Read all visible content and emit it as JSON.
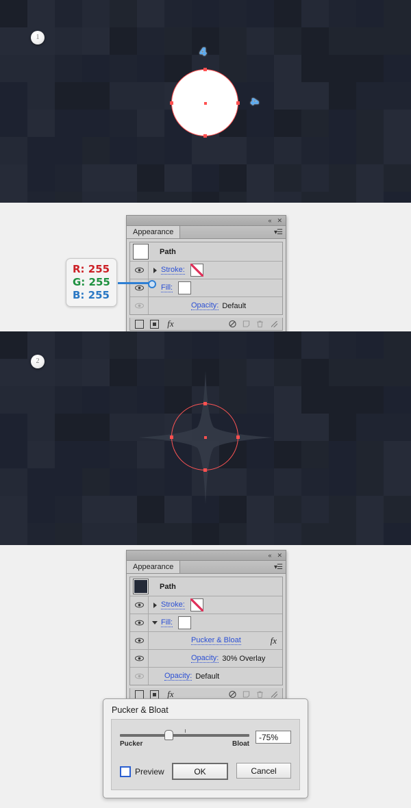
{
  "canvas_1": {
    "step_badge": "1",
    "cursor_labels": [
      "4",
      "4"
    ],
    "shape": "white-circle"
  },
  "canvas_2": {
    "step_badge": "2",
    "shape": "puckered-star"
  },
  "panel_1": {
    "title_icons": {
      "collapse": "«",
      "close": "✕"
    },
    "tab_label": "Appearance",
    "menu_icon": "panel-menu-icon",
    "header": {
      "object_label": "Path",
      "thumbnail": "white"
    },
    "rows": [
      {
        "eye": "on",
        "disclosure": "right",
        "label": "Stroke:",
        "value": "",
        "swatch": "none"
      },
      {
        "eye": "on",
        "disclosure": "none",
        "label": "Fill:",
        "value": "",
        "swatch": "white"
      },
      {
        "eye": "off",
        "disclosure": "none",
        "label": "Opacity:",
        "value": "Default",
        "swatch": ""
      }
    ],
    "footer_icons": [
      "new-stroke",
      "new-fill",
      "fx",
      "clear-appearance",
      "duplicate",
      "delete",
      "resize-grip"
    ],
    "fx_label": "fx"
  },
  "panel_2": {
    "title_icons": {
      "collapse": "«",
      "close": "✕"
    },
    "tab_label": "Appearance",
    "menu_icon": "panel-menu-icon",
    "header": {
      "object_label": "Path",
      "thumbnail": "dark"
    },
    "rows": [
      {
        "eye": "on",
        "disclosure": "right",
        "label": "Stroke:",
        "value": "",
        "swatch": "none"
      },
      {
        "eye": "on",
        "disclosure": "down",
        "label": "Fill:",
        "value": "",
        "swatch": "white"
      },
      {
        "eye": "on",
        "disclosure": "none",
        "label": "Pucker & Bloat",
        "value": "",
        "swatch": "",
        "fx": "fx"
      },
      {
        "eye": "on",
        "disclosure": "none",
        "label": "Opacity:",
        "value": "30% Overlay",
        "swatch": ""
      },
      {
        "eye": "off",
        "disclosure": "none",
        "label": "Opacity:",
        "value": "Default",
        "swatch": ""
      }
    ],
    "footer_icons": [
      "new-stroke",
      "new-fill",
      "fx",
      "clear-appearance",
      "duplicate",
      "delete",
      "resize-grip"
    ],
    "fx_label": "fx"
  },
  "callout": {
    "r_label": "R: 255",
    "g_label": "G: 255",
    "b_label": "B: 255",
    "colors": {
      "r": "#cc2026",
      "g": "#1e9140",
      "b": "#2a78c4",
      "connector": "#2d7fd4"
    }
  },
  "dialog": {
    "title": "Pucker & Bloat",
    "slider": {
      "left_label": "Pucker",
      "right_label": "Bloat",
      "value": "-75%",
      "knob_percent": 37
    },
    "preview_label": "Preview",
    "ok_label": "OK",
    "cancel_label": "Cancel"
  }
}
